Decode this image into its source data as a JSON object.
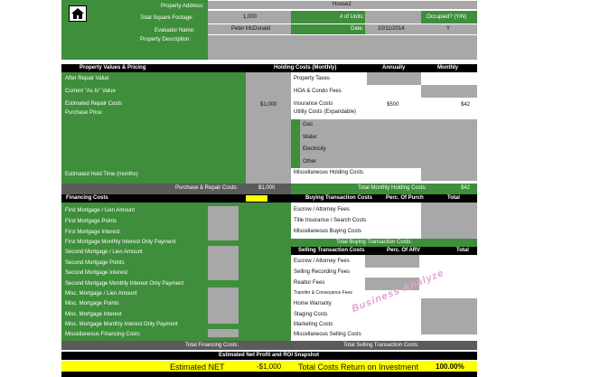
{
  "top": {
    "property_address_label": "Property Address:",
    "property_address_value": "House2",
    "total_sqft_label": "Total Square Footage:",
    "total_sqft_value": "1,000",
    "num_units_label": "# of Units:",
    "occupied_label": "Occupied? (Y/N)",
    "occupied_value": "Y",
    "evaluator_label": "Evaluator Name:",
    "evaluator_value": "Peter McDonald",
    "date_label": "Date:",
    "date_value": "10/11/2014",
    "description_label": "Property Description:"
  },
  "values_section": {
    "header": "Property Values & Pricing",
    "rows": [
      "After Repair Value",
      "Current \"As Is\" Value",
      "Estimated Repair Costs",
      "Purchase Price"
    ],
    "repair_value": "$1,000",
    "hold_time_label": "Estimated Hold Time (months)",
    "purchase_repair_label": "Purchase & Repair Costs:",
    "purchase_repair_value": "$1,000"
  },
  "holding": {
    "header": "Holding Costs (Monthly)",
    "annually": "Annually",
    "monthly": "Monthly",
    "rows": [
      "Property Taxes",
      "HOA & Condo Fees",
      "Insurance Costs",
      "Utility Costs (Expandable)",
      "Gas",
      "Water",
      "Electricity",
      "Other",
      "Miscellaneous Holding Costs"
    ],
    "insurance_annual": "$500",
    "insurance_monthly": "$42",
    "total_label": "Total Monthly Holding Costs:",
    "total_value": "$42"
  },
  "financing": {
    "header": "Financing Costs",
    "rows": [
      "First Mortgage / Lien Amount",
      "First Mortgage Points",
      "First Mortgage Interest",
      "First Mortgage Monthly Interest Only Payment",
      "Second Mortgage / Lien Amount",
      "Second Mortgage Points",
      "Second Mortgage Interest",
      "Second Mortgage Monthly Interest Only Payment",
      "Misc. Mortgage / Lien Amount",
      "Misc. Mortgage Points",
      "Misc. Mortgage Interest",
      "Misc. Mortgage Monthly Interest Only Payment",
      "Miscellaneous Financing Costs"
    ],
    "total_label": "Total Financing Costs:"
  },
  "buying": {
    "header": "Buying Transaction Costs",
    "perc_label": "Perc. Of Purch",
    "total_col": "Total",
    "rows": [
      "Escrow / Attorney Fees",
      "Title Insurance / Search Costs",
      "Miscellaneous Buying Costs"
    ],
    "total_label": "Total Buying Transaction Costs:"
  },
  "selling": {
    "header": "Selling Transaction Costs",
    "perc_label": "Perc. Of ARV",
    "total_col": "Total",
    "rows": [
      "Escrow / Attorney Fees",
      "Selling Recording Fees",
      "Realtor Fees",
      "Transfer & Conveyance Fees",
      "Home Warranty",
      "Staging Costs",
      "Marketing Costs",
      "Miscellaneous Selling Costs"
    ],
    "total_label": "Total Selling Transaction Costs:"
  },
  "snapshot": {
    "header": "Estimated Net Profit and ROI Snapshot",
    "net_label": "Estimated NET",
    "net_value": "-$1,000",
    "return_label": "Total Costs Return on Investment",
    "return_value": "100.00%"
  },
  "watermark": "Business Analyze"
}
